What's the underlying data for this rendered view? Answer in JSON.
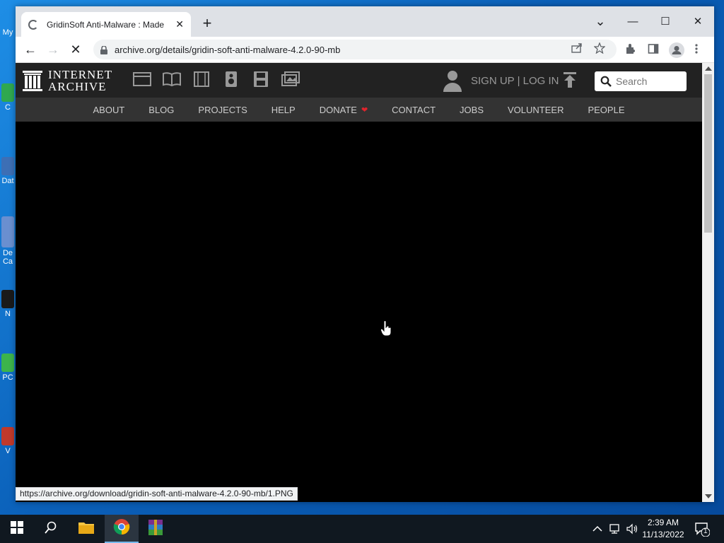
{
  "desktop": {
    "icons": [
      {
        "label": "My"
      },
      {
        "label": "C"
      },
      {
        "label": "Dat"
      },
      {
        "label": "De Ca"
      },
      {
        "label": "N"
      },
      {
        "label": "PC"
      },
      {
        "label": "V"
      }
    ]
  },
  "browser": {
    "tab_title": "GridinSoft Anti-Malware : Made",
    "tab_close": "✕",
    "new_tab": "+",
    "window_controls": {
      "tab_search": "⌄",
      "minimize": "—",
      "maximize": "☐",
      "close": "✕"
    },
    "back": "←",
    "forward": "→",
    "reload": "✕",
    "url": "archive.org/details/gridin-soft-anti-malware-4.2.0-90-mb",
    "status_url": "https://archive.org/download/gridin-soft-anti-malware-4.2.0-90-mb/1.PNG"
  },
  "archive": {
    "logo_line1": "INTERNET",
    "logo_line2": "ARCHIVE",
    "auth": "SIGN UP | LOG IN",
    "search_placeholder": "Search",
    "nav": [
      "ABOUT",
      "BLOG",
      "PROJECTS",
      "HELP",
      "DONATE",
      "CONTACT",
      "JOBS",
      "VOLUNTEER",
      "PEOPLE"
    ],
    "donate_heart": "❤"
  },
  "taskbar": {
    "clock_time": "2:39 AM",
    "clock_date": "11/13/2022",
    "notification_count": "1"
  },
  "colors": {
    "ia_header": "#222222",
    "ia_nav": "#333333",
    "page_bg": "#000000",
    "taskbar": "#101820",
    "chrome_frame": "#dee1e6"
  }
}
